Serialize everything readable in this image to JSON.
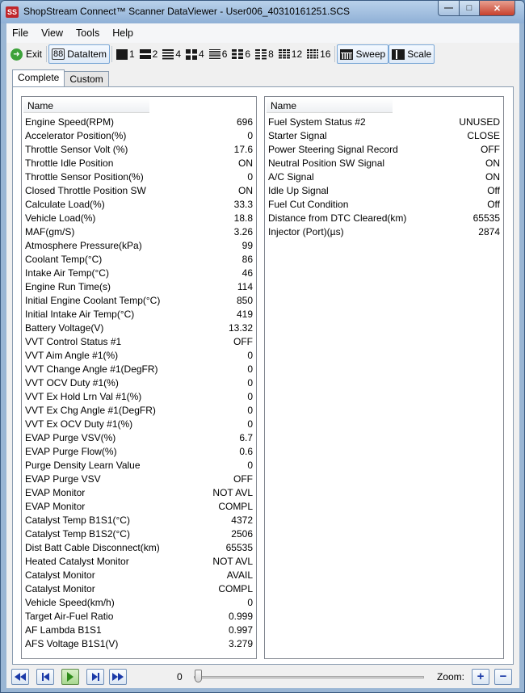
{
  "window": {
    "app_icon_text": "SS",
    "title": "ShopStream Connect™ Scanner DataViewer - User006_40310161251.SCS",
    "minimize_glyph": "—",
    "maximize_glyph": "□",
    "close_glyph": "✕"
  },
  "menu": [
    "File",
    "View",
    "Tools",
    "Help"
  ],
  "toolbar": {
    "exit": "Exit",
    "dataitem": "DataItem",
    "layouts": [
      "1",
      "2",
      "4",
      "4",
      "6",
      "6",
      "8",
      "12",
      "16"
    ],
    "sweep": "Sweep",
    "scale": "Scale"
  },
  "tabs": [
    "Complete",
    "Custom"
  ],
  "left_grid": {
    "header": "Name",
    "rows": [
      {
        "name": "Engine Speed(RPM)",
        "value": "696"
      },
      {
        "name": "Accelerator Position(%)",
        "value": "0"
      },
      {
        "name": "Throttle Sensor Volt (%)",
        "value": "17.6"
      },
      {
        "name": "Throttle Idle Position",
        "value": "ON"
      },
      {
        "name": "Throttle Sensor Position(%)",
        "value": "0"
      },
      {
        "name": "Closed Throttle Position SW",
        "value": "ON"
      },
      {
        "name": "Calculate Load(%)",
        "value": "33.3"
      },
      {
        "name": "Vehicle Load(%)",
        "value": "18.8"
      },
      {
        "name": "MAF(gm/S)",
        "value": "3.26"
      },
      {
        "name": "Atmosphere Pressure(kPa)",
        "value": "99"
      },
      {
        "name": "Coolant Temp(°C)",
        "value": "86"
      },
      {
        "name": "Intake Air Temp(°C)",
        "value": "46"
      },
      {
        "name": "Engine Run Time(s)",
        "value": "114"
      },
      {
        "name": "Initial Engine Coolant Temp(°C)",
        "value": "850"
      },
      {
        "name": "Initial Intake Air Temp(°C)",
        "value": "419"
      },
      {
        "name": "Battery Voltage(V)",
        "value": "13.32"
      },
      {
        "name": "VVT Control Status #1",
        "value": "OFF"
      },
      {
        "name": "VVT Aim Angle #1(%)",
        "value": "0"
      },
      {
        "name": "VVT Change Angle #1(DegFR)",
        "value": "0"
      },
      {
        "name": "VVT OCV Duty #1(%)",
        "value": "0"
      },
      {
        "name": "VVT Ex Hold Lrn Val #1(%)",
        "value": "0"
      },
      {
        "name": "VVT Ex Chg Angle #1(DegFR)",
        "value": "0"
      },
      {
        "name": "VVT Ex OCV Duty #1(%)",
        "value": "0"
      },
      {
        "name": "EVAP Purge VSV(%)",
        "value": "6.7"
      },
      {
        "name": "EVAP Purge Flow(%)",
        "value": "0.6"
      },
      {
        "name": "Purge Density Learn Value",
        "value": "0"
      },
      {
        "name": "EVAP Purge VSV",
        "value": "OFF"
      },
      {
        "name": "EVAP Monitor",
        "value": "NOT AVL"
      },
      {
        "name": "EVAP Monitor",
        "value": "COMPL"
      },
      {
        "name": "Catalyst Temp B1S1(°C)",
        "value": "4372"
      },
      {
        "name": "Catalyst Temp B1S2(°C)",
        "value": "2506"
      },
      {
        "name": "Dist Batt Cable Disconnect(km)",
        "value": "65535"
      },
      {
        "name": "Heated Catalyst Monitor",
        "value": "NOT AVL"
      },
      {
        "name": "Catalyst Monitor",
        "value": "AVAIL"
      },
      {
        "name": "Catalyst Monitor",
        "value": "COMPL"
      },
      {
        "name": "Vehicle Speed(km/h)",
        "value": "0"
      },
      {
        "name": "Target Air-Fuel Ratio",
        "value": "0.999"
      },
      {
        "name": "AF Lambda B1S1",
        "value": "0.997"
      },
      {
        "name": "AFS Voltage B1S1(V)",
        "value": "3.279"
      }
    ]
  },
  "right_grid": {
    "header": "Name",
    "rows": [
      {
        "name": "Fuel System Status #2",
        "value": "UNUSED"
      },
      {
        "name": "Starter Signal",
        "value": "CLOSE"
      },
      {
        "name": "Power Steering Signal Record",
        "value": "OFF"
      },
      {
        "name": "Neutral Position SW Signal",
        "value": "ON"
      },
      {
        "name": "A/C Signal",
        "value": "ON"
      },
      {
        "name": "Idle Up Signal",
        "value": "Off"
      },
      {
        "name": "Fuel Cut Condition",
        "value": "Off"
      },
      {
        "name": "Distance from DTC Cleared(km)",
        "value": "65535"
      },
      {
        "name": "Injector (Port)(µs)",
        "value": "2874"
      }
    ]
  },
  "playback": {
    "position": "0",
    "zoom_label": "Zoom:",
    "zoom_in_glyph": "+",
    "zoom_out_glyph": "−"
  }
}
